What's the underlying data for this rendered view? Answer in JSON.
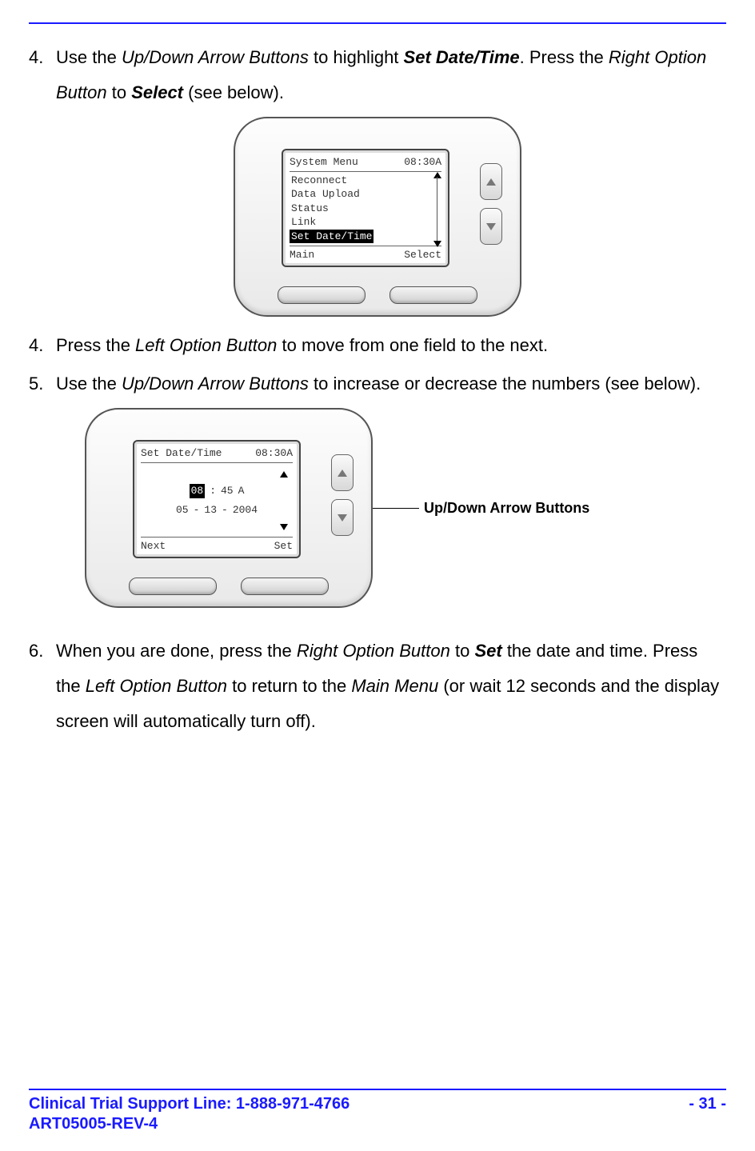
{
  "steps": {
    "s1": {
      "num": "4.",
      "t1": "Use the ",
      "t2": "Up/Down Arrow Buttons",
      "t3": " to highlight ",
      "t4": "Set Date/Time",
      "t5": ". Press the ",
      "t6": "Right Option Button",
      "t7": " to ",
      "t8": "Select",
      "t9": " (see below)."
    },
    "s2": {
      "num": "4.",
      "t1": "Press the ",
      "t2": "Left Option Button",
      "t3": " to move from one field to the next."
    },
    "s3": {
      "num": "5.",
      "t1": "Use the ",
      "t2": "Up/Down Arrow Buttons",
      "t3": " to increase or decrease the numbers (see below)."
    },
    "s4": {
      "num": "6.",
      "t1": "When you are done, press the ",
      "t2": "Right Option Button",
      "t3": " to ",
      "t4": "Set",
      "t5": " the date and time. Press the ",
      "t6": "Left Option Button",
      "t7": " to return to the ",
      "t8": "Main Menu",
      "t9": " (or wait 12 seconds and the display screen will automatically turn off)."
    }
  },
  "device1": {
    "title": "System Menu",
    "clock": "08:30A",
    "items": [
      "Reconnect",
      "Data Upload",
      "Status",
      "Link",
      "Set Date/Time"
    ],
    "selected_index": 4,
    "left_soft": "Main",
    "right_soft": "Select"
  },
  "device2": {
    "title": "Set Date/Time",
    "clock": "08:30A",
    "time": {
      "hh": "08",
      "mm": "45",
      "ampm": "A"
    },
    "date": {
      "mm": "05",
      "dd": "13",
      "yyyy": "2004"
    },
    "highlight": "time.hh",
    "left_soft": "Next",
    "right_soft": "Set",
    "callout": "Up/Down Arrow Buttons"
  },
  "footer": {
    "support_line_label": "Clinical Trial Support Line:  1-888-971-4766",
    "doc_id": "ART05005-REV-4",
    "page": "- 31 -"
  }
}
